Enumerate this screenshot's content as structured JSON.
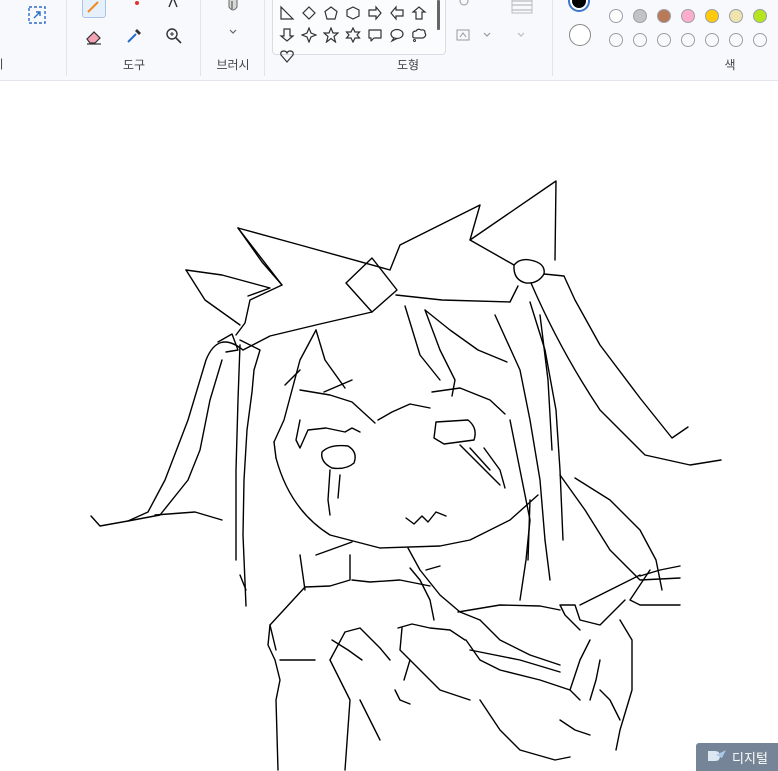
{
  "ribbon": {
    "groups": {
      "tools": "도구",
      "brushes": "브러시",
      "shapes": "도형",
      "colors": "색"
    }
  },
  "colors": {
    "primary": "#000000",
    "secondary": "#ffffff",
    "palette_row1": [
      "#ffffff",
      "#c3c3c3",
      "#b97a57",
      "#ffaec9",
      "#ffc90e",
      "#efe4b0",
      "#b5e61d"
    ],
    "palette_row2": [
      "#ffffff",
      "#ffffff",
      "#ffffff",
      "#ffffff",
      "#ffffff",
      "#ffffff",
      "#ffffff"
    ]
  },
  "watermark": {
    "text": "디지털"
  }
}
